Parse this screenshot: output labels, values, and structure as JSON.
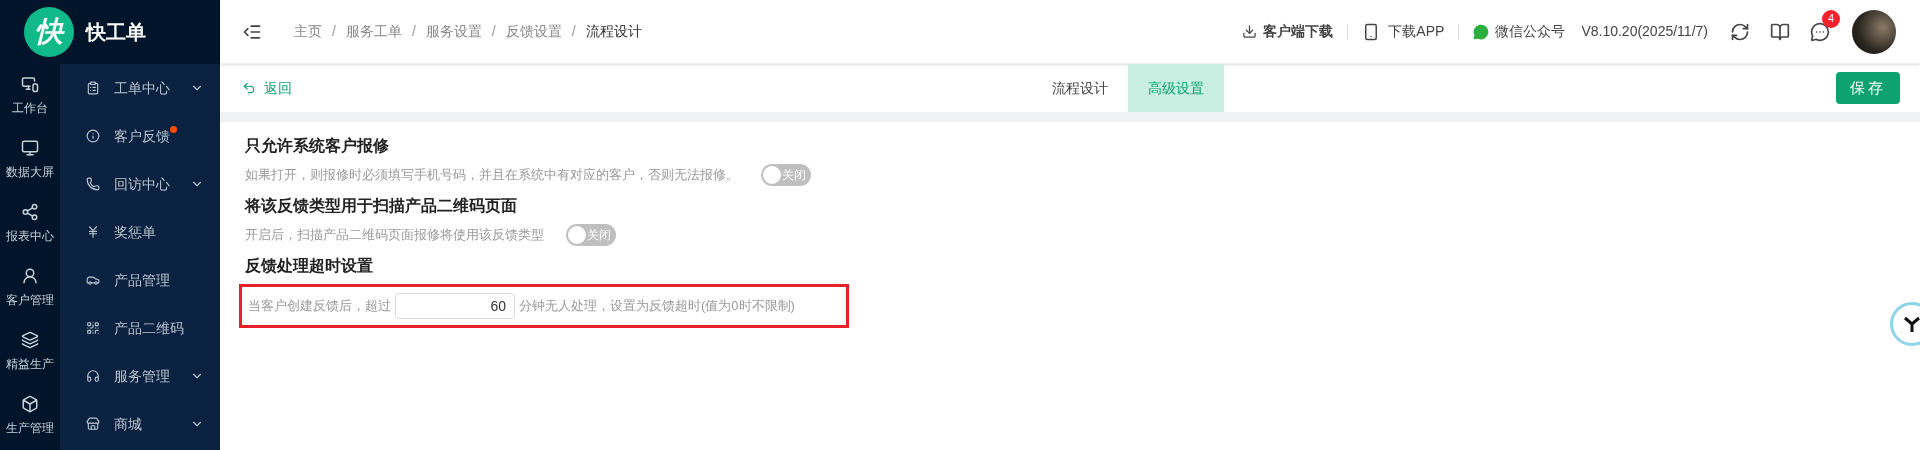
{
  "logo": {
    "mark": "快",
    "name": "快工单"
  },
  "rail": [
    {
      "label": "工作台"
    },
    {
      "label": "数据大屏"
    },
    {
      "label": "报表中心"
    },
    {
      "label": "客户管理"
    },
    {
      "label": "精益生产"
    },
    {
      "label": "生产管理"
    }
  ],
  "submenu": [
    {
      "label": "工单中心",
      "expandable": true,
      "dot": false
    },
    {
      "label": "客户反馈",
      "expandable": false,
      "dot": true
    },
    {
      "label": "回访中心",
      "expandable": true,
      "dot": false
    },
    {
      "label": "奖惩单",
      "expandable": false,
      "dot": false
    },
    {
      "label": "产品管理",
      "expandable": false,
      "dot": false
    },
    {
      "label": "产品二维码",
      "expandable": false,
      "dot": false
    },
    {
      "label": "服务管理",
      "expandable": true,
      "dot": false
    },
    {
      "label": "商城",
      "expandable": true,
      "dot": false
    }
  ],
  "breadcrumb": [
    {
      "label": "主页",
      "selected": false
    },
    {
      "label": "服务工单",
      "selected": false
    },
    {
      "label": "服务设置",
      "selected": false
    },
    {
      "label": "反馈设置",
      "selected": false
    },
    {
      "label": "流程设计",
      "selected": true
    }
  ],
  "breadcrumb_separator": "/",
  "header_links": [
    "客户端下载",
    "下载APP",
    "微信公众号"
  ],
  "version": "V8.10.20(2025/11/7)",
  "message_badge": "4",
  "back": "返回",
  "tabs": [
    {
      "label": "流程设计",
      "selected": false
    },
    {
      "label": "高级设置",
      "selected": true
    }
  ],
  "save": "保存",
  "settings": [
    {
      "kind": "toggle",
      "title": "只允许系统客户报修",
      "description": "如果打开，则报修时必须填写手机号码，并且在系统中有对应的客户，否则无法报修。",
      "on": false,
      "toggle_label": "关闭"
    },
    {
      "kind": "toggle",
      "title": "将该反馈类型用于扫描产品二维码页面",
      "description": "开启后，扫描产品二维码页面报修将使用该反馈类型",
      "on": false,
      "toggle_label": "关闭"
    },
    {
      "kind": "timeout",
      "title": "反馈处理超时设置",
      "prefix": "当客户创建反馈后，超过",
      "value": "60",
      "suffix": "分钟无人处理，设置为反馈超时(值为0时不限制)",
      "highlighted": true
    }
  ]
}
